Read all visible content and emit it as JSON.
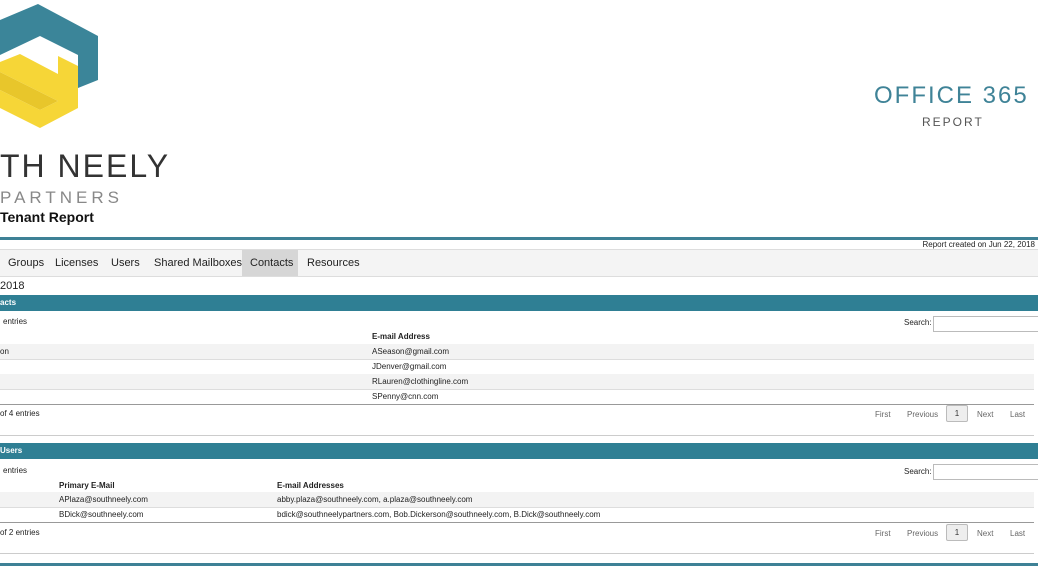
{
  "header": {
    "logo_word": "TH NEELY",
    "logo_sub": "PARTNERS",
    "tenant_title": "Tenant Report",
    "product_title": "OFFICE 365",
    "product_sub": "REPORT",
    "created_text": "Report created on Jun 22, 2018"
  },
  "tabs": [
    {
      "label": "Groups",
      "active": false
    },
    {
      "label": "Licenses",
      "active": false
    },
    {
      "label": "Users",
      "active": false
    },
    {
      "label": "Shared Mailboxes",
      "active": false
    },
    {
      "label": "Contacts",
      "active": true
    },
    {
      "label": "Resources",
      "active": false
    }
  ],
  "date_label": "2018",
  "contacts": {
    "section_title": "acts",
    "length_label": "entries",
    "search_label": "Search:",
    "search_value": "",
    "columns": [
      "E-mail Address"
    ],
    "rows": [
      {
        "name": "on",
        "email": "ASeason@gmail.com"
      },
      {
        "name": "",
        "email": "JDenver@gmail.com"
      },
      {
        "name": "",
        "email": "RLauren@clothingline.com"
      },
      {
        "name": "",
        "email": "SPenny@cnn.com"
      }
    ],
    "info": "of 4 entries",
    "pager": {
      "first": "First",
      "previous": "Previous",
      "current": "1",
      "next": "Next",
      "last": "Last"
    }
  },
  "users": {
    "section_title": "Users",
    "length_label": "entries",
    "search_label": "Search:",
    "search_value": "",
    "columns": [
      "Primary E-Mail",
      "E-mail Addresses"
    ],
    "rows": [
      {
        "primary": "APlaza@southneely.com",
        "addresses": "abby.plaza@southneely.com, a.plaza@southneely.com"
      },
      {
        "primary": "BDick@southneely.com",
        "addresses": "bdick@southneelypartners.com, Bob.Dickerson@southneely.com, B.Dick@southneely.com"
      }
    ],
    "info": "of 2 entries",
    "pager": {
      "first": "First",
      "previous": "Previous",
      "current": "1",
      "next": "Next",
      "last": "Last"
    }
  },
  "colors": {
    "accent": "#2f7f94",
    "brand_yellow": "#f6d637",
    "brand_teal": "#3b8599"
  }
}
